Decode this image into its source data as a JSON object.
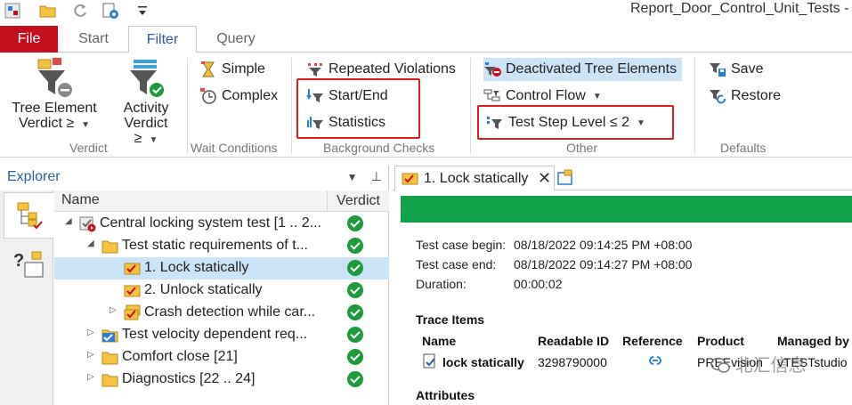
{
  "window": {
    "title": "Report_Door_Control_Unit_Tests - V"
  },
  "ribbon_tabs": [
    "File",
    "Start",
    "Filter",
    "Query"
  ],
  "ribbon": {
    "verdict": {
      "tree_element": [
        "Tree Element",
        "Verdict ≥"
      ],
      "activity": [
        "Activity",
        "Verdict ≥"
      ],
      "label": "Verdict"
    },
    "wait_conditions": {
      "simple": "Simple",
      "complex": "Complex",
      "label": "Wait Conditions"
    },
    "background_checks": {
      "repeated_violations": "Repeated Violations",
      "start_end": "Start/End",
      "statistics": "Statistics",
      "label": "Background Checks"
    },
    "other": {
      "deactivated": "Deactivated Tree Elements",
      "control_flow": "Control Flow",
      "test_step_level": "Test Step Level ≤ 2",
      "label": "Other"
    },
    "defaults": {
      "save": "Save",
      "restore": "Restore",
      "label": "Defaults"
    }
  },
  "explorer": {
    "title": "Explorer",
    "columns": {
      "name": "Name",
      "verdict": "Verdict"
    },
    "rows": [
      {
        "label": "Central locking system test [1 .. 2...",
        "indent": 0,
        "expander": "◢",
        "icon": "testmodule-icon",
        "selected": false
      },
      {
        "label": "Test static requirements of t...",
        "indent": 1,
        "expander": "◢",
        "icon": "folder-icon",
        "selected": false
      },
      {
        "label": "1. Lock statically",
        "indent": 2,
        "expander": "",
        "icon": "testcase-icon",
        "selected": true
      },
      {
        "label": "2. Unlock statically",
        "indent": 2,
        "expander": "",
        "icon": "testcase-icon",
        "selected": false
      },
      {
        "label": "Crash detection while car...",
        "indent": 2,
        "expander": "▷",
        "icon": "testcase-group-icon",
        "selected": false
      },
      {
        "label": "Test velocity dependent req...",
        "indent": 1,
        "expander": "▷",
        "icon": "checked-folder-icon",
        "selected": false
      },
      {
        "label": "Comfort close [21]",
        "indent": 1,
        "expander": "▷",
        "icon": "folder-icon",
        "selected": false
      },
      {
        "label": "Diagnostics [22 .. 24]",
        "indent": 1,
        "expander": "▷",
        "icon": "folder-icon",
        "selected": false
      }
    ]
  },
  "report": {
    "tab_label": "1. Lock statically",
    "status_color": "#12a24a",
    "info": [
      {
        "key": "Test case begin:",
        "value": "08/18/2022 09:14:25 PM +08:00"
      },
      {
        "key": "Test case end:",
        "value": "08/18/2022 09:14:27 PM +08:00"
      },
      {
        "key": "Duration:",
        "value": "00:00:02"
      }
    ],
    "trace_items": {
      "title": "Trace Items",
      "headers": [
        "Name",
        "Readable ID",
        "Reference",
        "Product",
        "Managed by"
      ],
      "row": {
        "name": "lock statically",
        "readable_id": "3298790000",
        "product": "PREEvision",
        "managed_by": "vTESTstudio"
      }
    },
    "attributes_title": "Attributes"
  },
  "watermark": "北汇信息"
}
